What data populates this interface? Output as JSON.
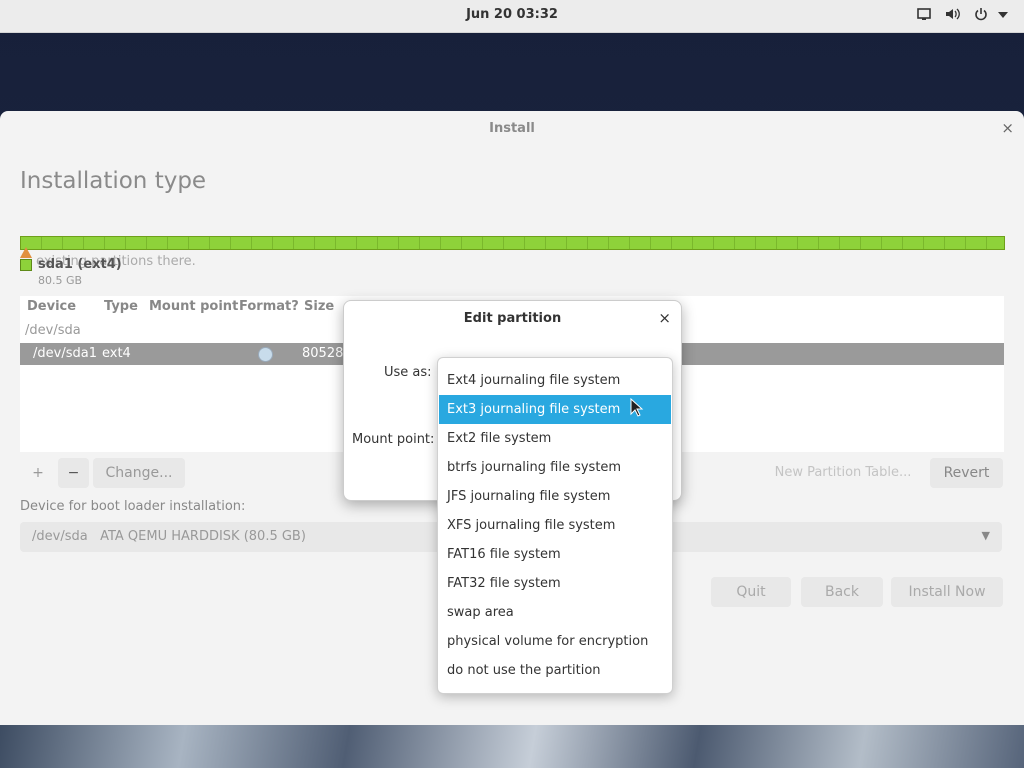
{
  "topbar": {
    "clock": "Jun 20  03:32"
  },
  "window": {
    "title": "Install",
    "close": "×",
    "heading": "Installation type",
    "bg_text": "existing partitions there.",
    "partition": {
      "name": "sda1 (ext4)",
      "size": "80.5 GB"
    },
    "table": {
      "headers": [
        "Device",
        "Type",
        "Mount point",
        "Format?",
        "Size"
      ],
      "rows": [
        {
          "device": "/dev/sda"
        },
        {
          "device": "/dev/sda1",
          "type": "ext4",
          "size": "80528"
        }
      ]
    },
    "buttons": {
      "add": "+",
      "remove": "−",
      "change": "Change...",
      "new_table": "New Partition Table...",
      "revert": "Revert"
    },
    "bootloader": {
      "label": "Device for boot loader installation:",
      "value": "/dev/sda   ATA QEMU HARDDISK (80.5 GB)"
    },
    "actions": {
      "quit": "Quit",
      "back": "Back",
      "install": "Install Now"
    }
  },
  "dialog": {
    "title": "Edit partition",
    "close": "×",
    "use_as_label": "Use as:",
    "mount_label": "Mount point:",
    "options": [
      "Ext4 journaling file system",
      "Ext3 journaling file system",
      "Ext2 file system",
      "btrfs journaling file system",
      "JFS journaling file system",
      "XFS journaling file system",
      "FAT16 file system",
      "FAT32 file system",
      "swap area",
      "physical volume for encryption",
      "do not use the partition"
    ],
    "highlighted_index": 1
  },
  "colors": {
    "highlight": "#29a8e0",
    "partition_bar": "#8ed23a",
    "selected_row": "#9a9a9a"
  }
}
